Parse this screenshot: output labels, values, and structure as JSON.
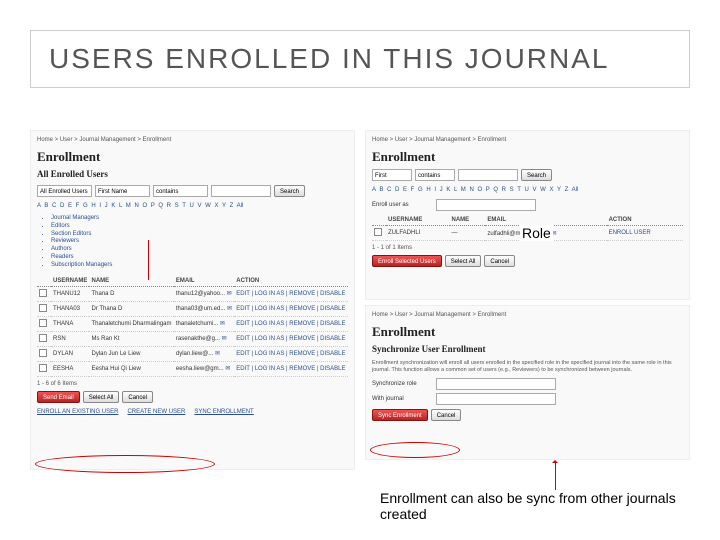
{
  "slide": {
    "title": "USERS ENROLLED IN THIS JOURNAL"
  },
  "annotations": {
    "role_label": "Role",
    "caption": "Enrollment can also be sync from other journals created"
  },
  "left": {
    "breadcrumb": "Home > User > Journal Management > Enrollment",
    "heading": "Enrollment",
    "subheading": "All Enrolled Users",
    "filter": {
      "f1": "All Enrolled Users",
      "f2": "First Name",
      "f3": "contains",
      "search": "Search"
    },
    "alpha": "A B C D E F G H I J K L M N O P Q R S T U V W X Y Z All",
    "roles": [
      "Journal Managers",
      "Editors",
      "Section Editors",
      "Reviewers",
      "Authors",
      "Readers",
      "Subscription Managers"
    ],
    "th": {
      "c1": "USERNAME",
      "c2": "NAME",
      "c3": "EMAIL",
      "c4": "ACTION"
    },
    "rows": [
      {
        "u": "THANU12",
        "n": "Thana D",
        "e": "thanu12@yahoo...",
        "a": "EDIT | LOG IN AS | REMOVE | DISABLE"
      },
      {
        "u": "THANA03",
        "n": "Dr Thana D",
        "e": "thana03@um.ed...",
        "a": "EDIT | LOG IN AS | REMOVE | DISABLE"
      },
      {
        "u": "THANA",
        "n": "Thanaletchumi Dharmalingam",
        "e": "thanaletchumi...",
        "a": "EDIT | LOG IN AS | REMOVE | DISABLE"
      },
      {
        "u": "RSN",
        "n": "Ms Ran Kt",
        "e": "rasenakthe@g...",
        "a": "EDIT | LOG IN AS | REMOVE | DISABLE"
      },
      {
        "u": "DYLAN",
        "n": "Dylan Jun Le Liew",
        "e": "dylan.liew@...",
        "a": "EDIT | LOG IN AS | REMOVE | DISABLE"
      },
      {
        "u": "EESHA",
        "n": "Eesha Hui Qi Liew",
        "e": "eesha.liew@gm...",
        "a": "EDIT | LOG IN AS | REMOVE | DISABLE"
      }
    ],
    "count": "1 - 6 of 6 Items",
    "btns": {
      "send": "Send Email",
      "selall": "Select All",
      "cancel": "Cancel",
      "enroll_existing": "ENROLL AN EXISTING USER",
      "create_new": "CREATE NEW USER",
      "sync": "SYNC ENROLLMENT"
    }
  },
  "rt": {
    "breadcrumb": "Home > User > Journal Management > Enrollment",
    "heading": "Enrollment",
    "filter": {
      "f1": "First",
      "f2": "contains",
      "search": "Search"
    },
    "alpha": "A B C D E F G H I J K L M N O P Q R S T U V W X Y Z All",
    "enroll_as": "Enroll user as",
    "th": {
      "c1": "USERNAME",
      "c2": "NAME",
      "c3": "EMAIL",
      "c4": "ACTION"
    },
    "rows": [
      {
        "u": "ZULFADHLI",
        "n": "—",
        "e": "zulfadhli@me.g...by (E)",
        "a": "ENROLL USER"
      }
    ],
    "count": "1 - 1 of 1 Items",
    "btns": {
      "enroll": "Enroll Selected Users",
      "selall": "Select All",
      "cancel": "Cancel"
    }
  },
  "rb": {
    "breadcrumb": "Home > User > Journal Management > Enrollment",
    "heading": "Enrollment",
    "subheading": "Synchronize User Enrollment",
    "desc": "Enrollment synchronization will enroll all users enrolled in the specified role in the specified journal into the same role in this journal. This function allows a common set of users (e.g., Reviewers) to be synchronized between journals.",
    "labels": {
      "sync_role": "Synchronize role",
      "with_journal": "With journal"
    },
    "btns": {
      "sync": "Sync Enrollment",
      "cancel": "Cancel"
    }
  }
}
